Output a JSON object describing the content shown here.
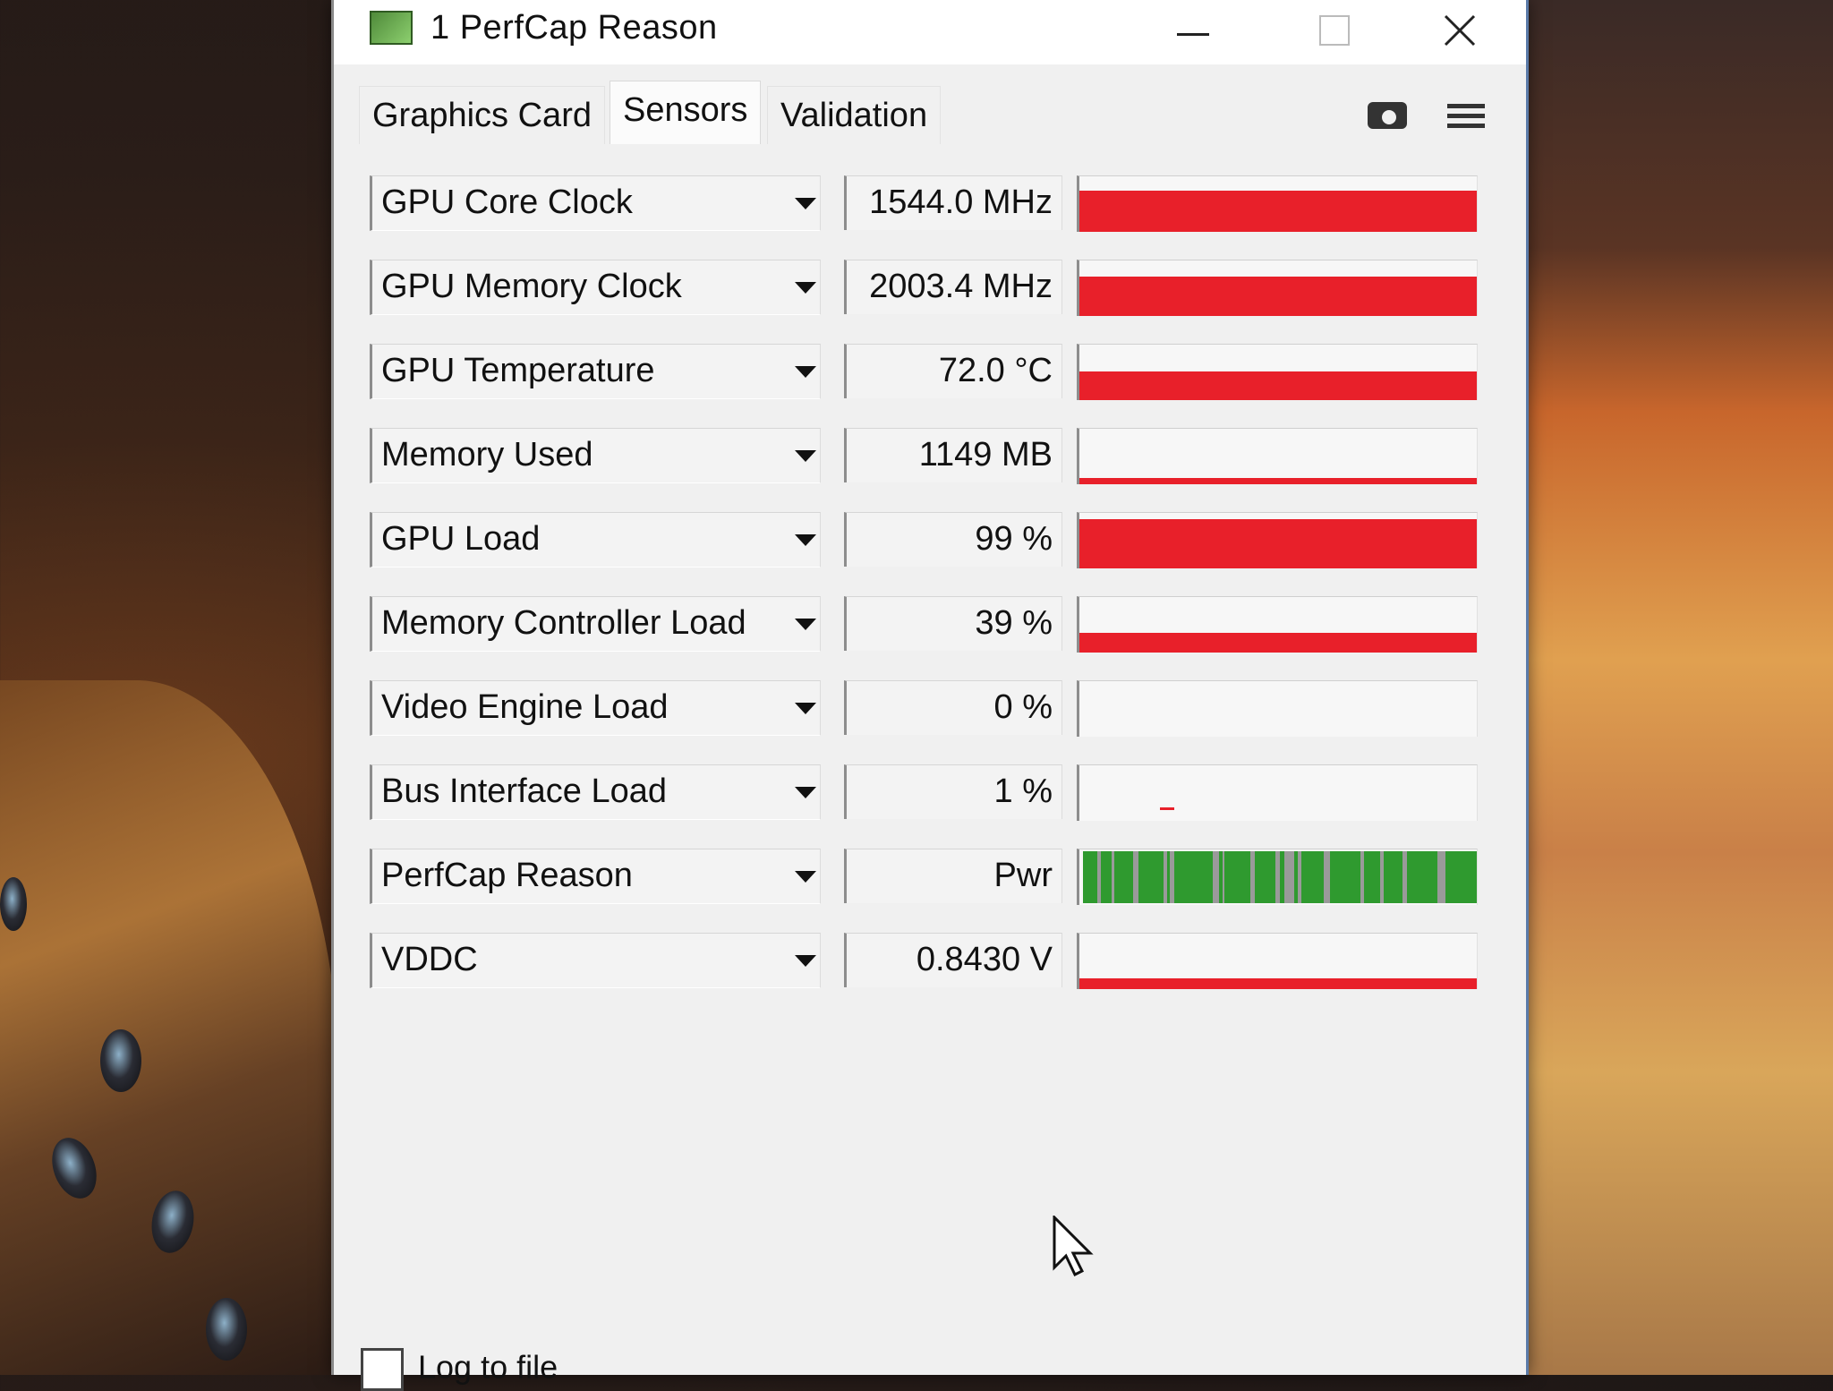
{
  "window": {
    "title": "1  PerfCap Reason",
    "icon": "gpu-z-app-icon",
    "controls": [
      "minimize",
      "maximize",
      "close"
    ]
  },
  "tabs": [
    {
      "label": "Graphics Card",
      "active": false
    },
    {
      "label": "Sensors",
      "active": true
    },
    {
      "label": "Validation",
      "active": false
    }
  ],
  "toolbar": {
    "screenshot_icon": "camera-icon",
    "menu_icon": "hamburger-menu-icon"
  },
  "sensors": [
    {
      "name": "GPU Core Clock",
      "value": "1544.0 MHz",
      "graph_level": 0.8
    },
    {
      "name": "GPU Memory Clock",
      "value": "2003.4 MHz",
      "graph_level": 0.75
    },
    {
      "name": "GPU Temperature",
      "value": "72.0 °C",
      "graph_level": 0.55
    },
    {
      "name": "Memory Used",
      "value": "1149 MB",
      "graph_level": 0.12
    },
    {
      "name": "GPU Load",
      "value": "99 %",
      "graph_level": 0.95
    },
    {
      "name": "Memory Controller Load",
      "value": "39 %",
      "graph_level": 0.38
    },
    {
      "name": "Video Engine Load",
      "value": "0 %",
      "graph_level": 0.0
    },
    {
      "name": "Bus Interface Load",
      "value": "1 %",
      "graph_level": 0.02
    },
    {
      "name": "PerfCap Reason",
      "value": "Pwr",
      "graph_level": 1.0
    },
    {
      "name": "VDDC",
      "value": "0.8430 V",
      "graph_level": 0.2
    }
  ],
  "footer": {
    "log_to_file_label": "Log to file",
    "log_to_file_checked": false
  },
  "colors": {
    "graph_red": "#e8202a",
    "perfcap_green": "#2f9a2f",
    "perfcap_gray": "#9a9a9a"
  }
}
